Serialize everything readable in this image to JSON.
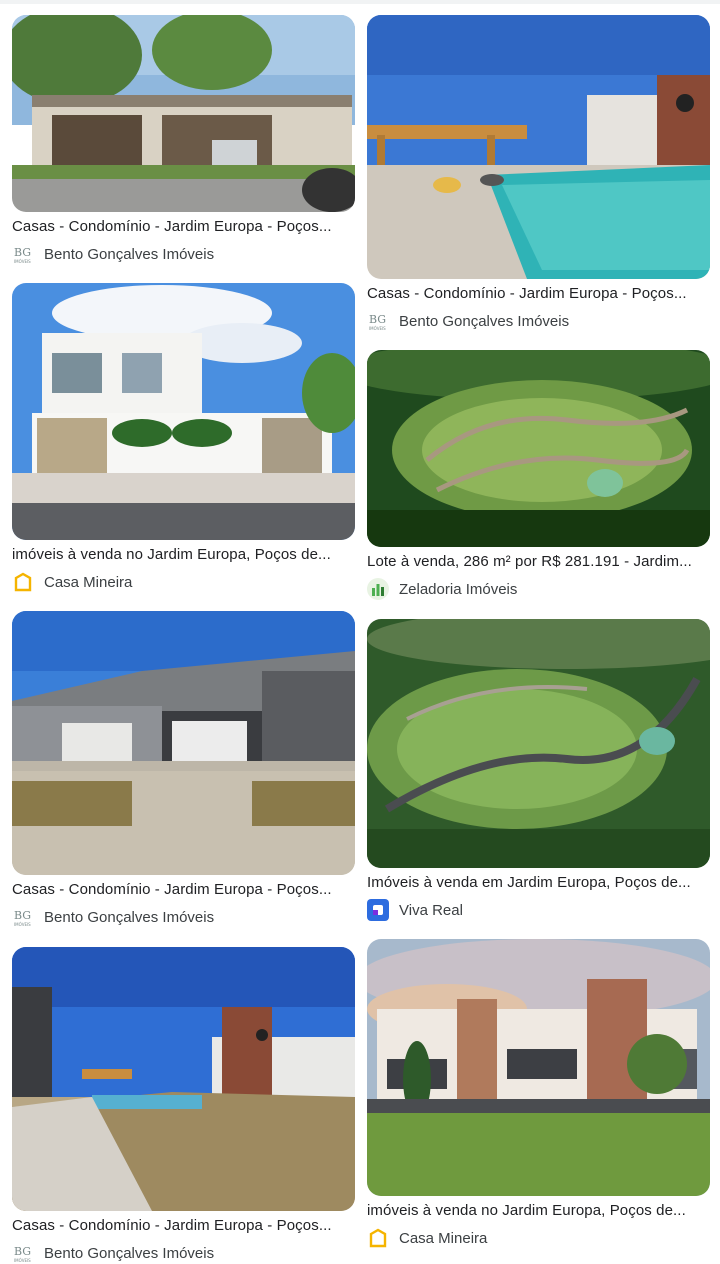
{
  "results": [
    {
      "title": "Casas - Condomínio - Jardim Europa - Poços...",
      "source": "Bento Gonçalves Imóveis",
      "logo": "bg-imoveis-logo"
    },
    {
      "title": "Casas - Condomínio - Jardim Europa - Poços...",
      "source": "Bento Gonçalves Imóveis",
      "logo": "bg-imoveis-logo"
    },
    {
      "title": "imóveis à venda no Jardim Europa, Poços de...",
      "source": "Casa Mineira",
      "logo": "casa-mineira-logo"
    },
    {
      "title": "Lote à venda, 286 m² por R$ 281.191 - Jardim...",
      "source": "Zeladoria Imóveis",
      "logo": "zeladoria-logo"
    },
    {
      "title": "Casas - Condomínio - Jardim Europa - Poços...",
      "source": "Bento Gonçalves Imóveis",
      "logo": "bg-imoveis-logo"
    },
    {
      "title": "Imóveis à venda em Jardim Europa, Poços de...",
      "source": "Viva Real",
      "logo": "viva-real-logo"
    },
    {
      "title": "Casas - Condomínio - Jardim Europa - Poços...",
      "source": "Bento Gonçalves Imóveis",
      "logo": "bg-imoveis-logo"
    },
    {
      "title": "imóveis à venda no Jardim Europa, Poços de...",
      "source": "Casa Mineira",
      "logo": "casa-mineira-logo"
    }
  ],
  "colors": {
    "casa_mineira": "#f5b400",
    "zeladoria": "#4caf50",
    "viva_real": "#2d6cdf",
    "bg_imoveis": "#7a8a8a"
  }
}
